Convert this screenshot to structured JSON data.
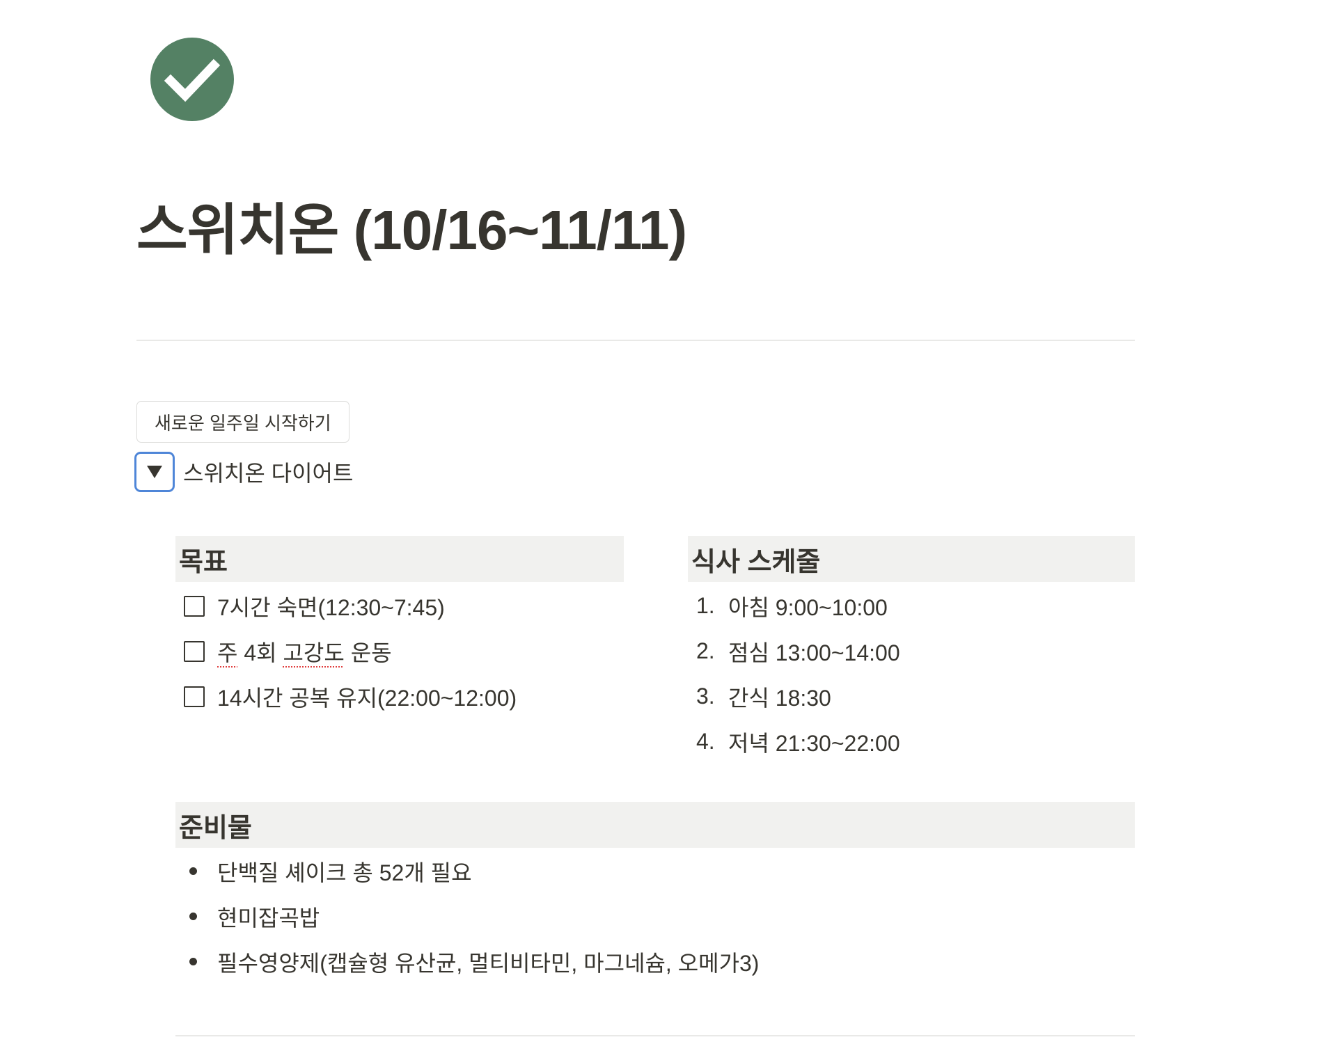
{
  "page": {
    "icon": "check-circle-icon",
    "icon_color": "#548164",
    "title": "스위치온 (10/16~11/11)"
  },
  "button": {
    "label": "새로운 일주일 시작하기"
  },
  "toggle": {
    "label": "스위치온 다이어트",
    "icon": "triangle-down-icon",
    "state": "expanded"
  },
  "goals": {
    "title": "목표",
    "items": [
      {
        "pre": "7시간 숙면(12:30~7:45)",
        "checked": false
      },
      {
        "pre": "주",
        "mid1": " 4회 ",
        "flag": "고강도",
        "post": " 운동",
        "checked": false
      },
      {
        "pre": "14시간 공복 유지(22:00~12:00)",
        "checked": false
      }
    ]
  },
  "meals": {
    "title": "식사 스케줄",
    "items": [
      {
        "num": "1.",
        "text": "아침 9:00~10:00"
      },
      {
        "num": "2.",
        "text": "점심 13:00~14:00"
      },
      {
        "num": "3.",
        "text": "간식 18:30"
      },
      {
        "num": "4.",
        "text": "저녁 21:30~22:00"
      }
    ]
  },
  "supplies": {
    "title": "준비물",
    "items": [
      "단백질 셰이크 총 52개 필요",
      "현미잡곡밥",
      "필수영양제(캡슐형 유산균, 멀티비타민, 마그네슘, 오메가3)"
    ]
  },
  "colors": {
    "text": "#37352f",
    "header_bg": "#f1f1ef",
    "focus_ring": "#4f86d8",
    "spellcheck": "#e03e3e"
  }
}
